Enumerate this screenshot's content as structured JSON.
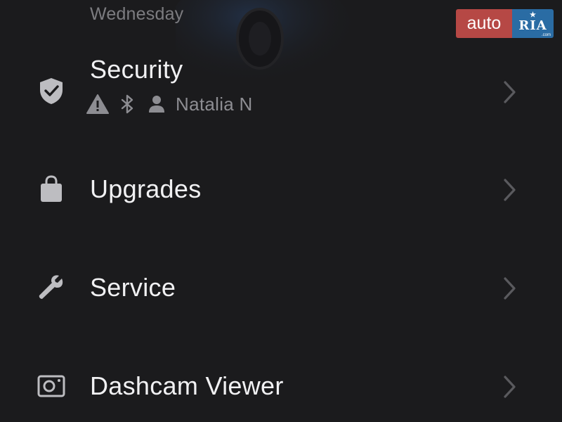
{
  "header": {
    "day": "Wednesday"
  },
  "watermark": {
    "auto": "auto",
    "ria": "RIA",
    "com": ".com"
  },
  "menu": {
    "security": {
      "label": "Security",
      "user": "Natalia N",
      "status_icons": [
        "warning-icon",
        "bluetooth-icon",
        "person-icon"
      ]
    },
    "upgrades": {
      "label": "Upgrades"
    },
    "service": {
      "label": "Service"
    },
    "dashcam": {
      "label": "Dashcam Viewer"
    }
  },
  "colors": {
    "background": "#1b1b1d",
    "label": "#f1f1f3",
    "muted": "#8d8d92",
    "icon": "#bdbdc1",
    "chevron": "#5a5a5e",
    "logo_red": "#b64845",
    "logo_blue": "#2a6ca4"
  }
}
